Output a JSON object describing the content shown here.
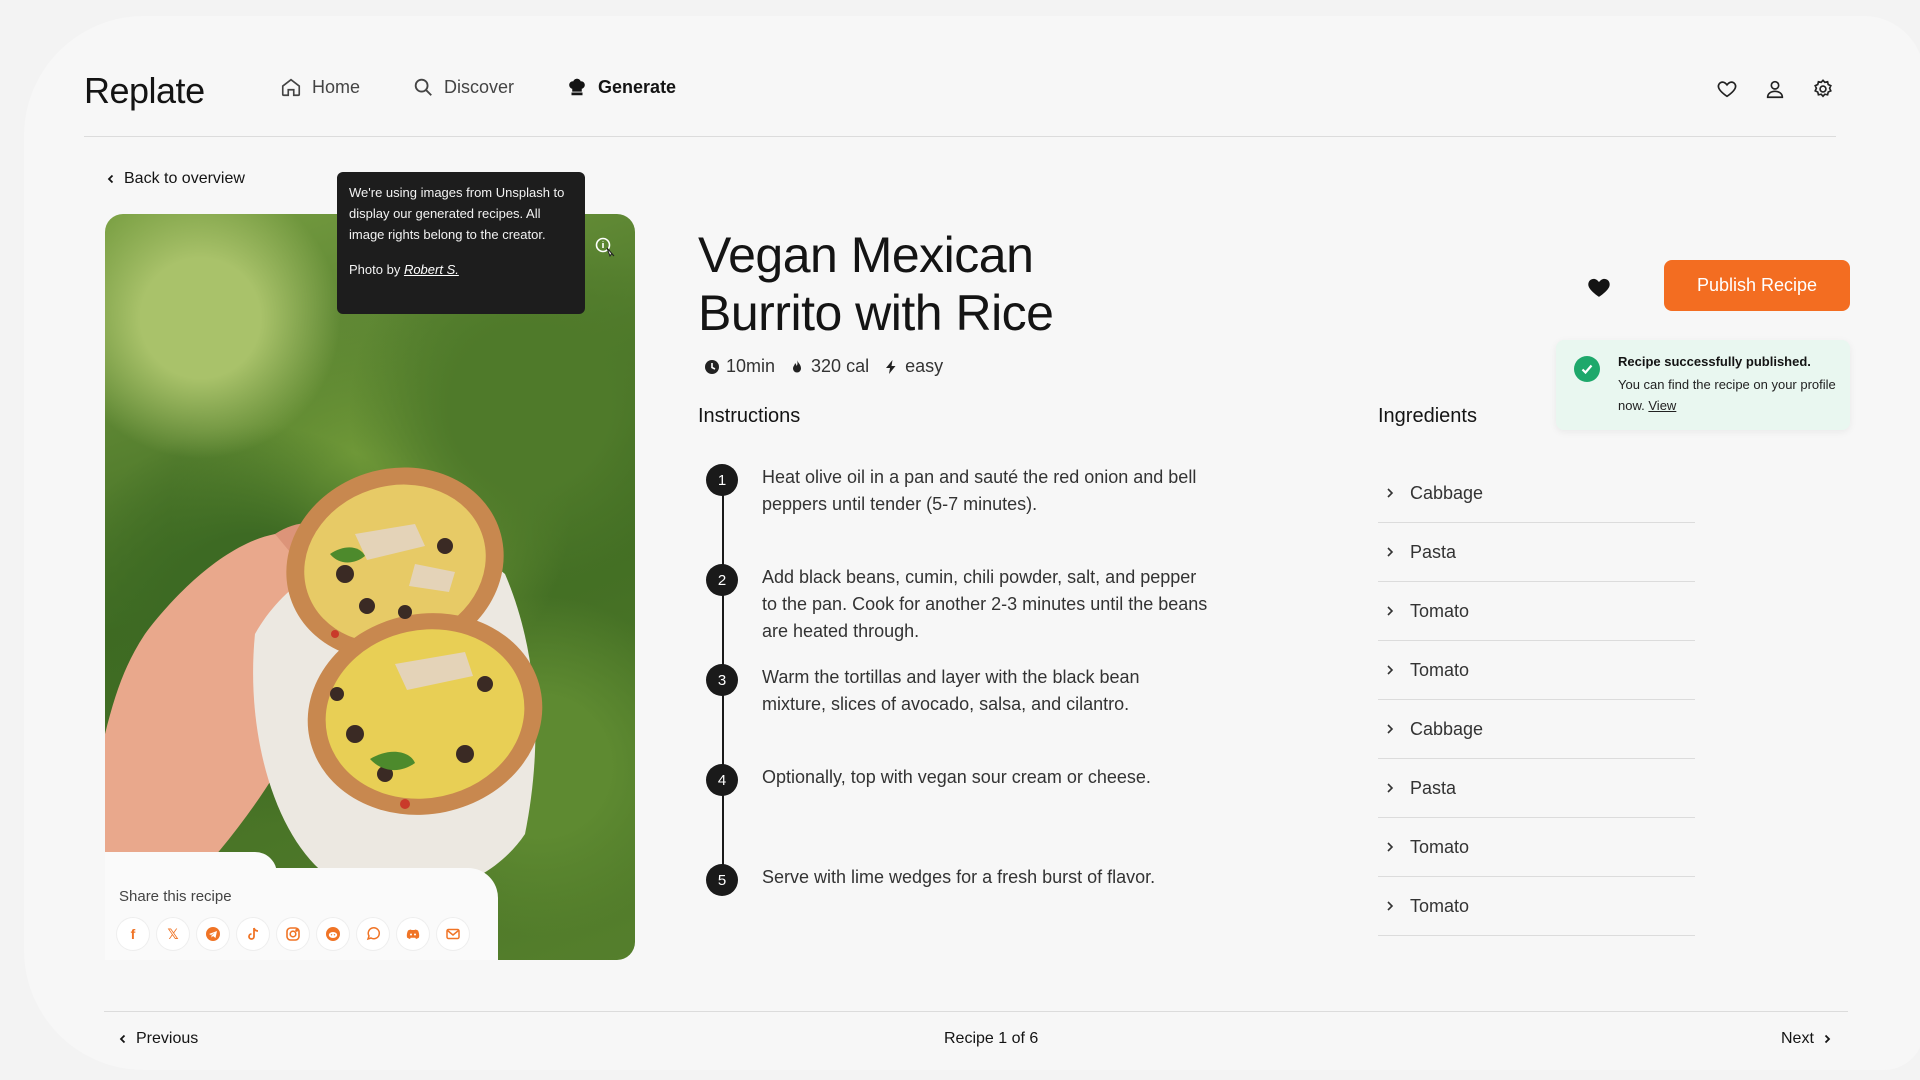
{
  "app": {
    "logo": "Replate"
  },
  "nav": [
    {
      "label": "Home",
      "icon": "home-icon",
      "active": false
    },
    {
      "label": "Discover",
      "icon": "search-icon",
      "active": false
    },
    {
      "label": "Generate",
      "icon": "chef-hat-icon",
      "active": true
    }
  ],
  "header_icons": [
    "heart-icon",
    "user-icon",
    "gear-icon"
  ],
  "back_label": "Back to overview",
  "tooltip": {
    "text": "We're using images from Unsplash to display our generated recipes. All image rights belong to the creator.",
    "credit_prefix": "Photo by ",
    "credit_name": "Robert S."
  },
  "share": {
    "title": "Share this recipe",
    "networks": [
      "facebook",
      "x",
      "telegram",
      "tiktok",
      "instagram",
      "reddit",
      "whatsapp",
      "discord",
      "email"
    ]
  },
  "recipe": {
    "title_line1": "Vegan Mexican",
    "title_line2": "Burrito with Rice",
    "time": "10min",
    "calories": "320 cal",
    "difficulty": "easy"
  },
  "actions": {
    "publish_label": "Publish Recipe"
  },
  "toast": {
    "title": "Recipe successfully published.",
    "body": "You can find the recipe on your profile now.",
    "link": "View"
  },
  "instructions": {
    "heading": "Instructions",
    "steps": [
      {
        "num": "1",
        "text": "Heat olive oil in a pan and sauté the red onion and bell peppers until tender (5-7 minutes)."
      },
      {
        "num": "2",
        "text": "Add black beans, cumin, chili powder, salt, and pepper to the pan. Cook for another 2-3 minutes until the beans are heated through."
      },
      {
        "num": "3",
        "text": "Warm the tortillas and layer with the black bean mixture, slices of avocado, salsa, and cilantro."
      },
      {
        "num": "4",
        "text": "Optionally, top with vegan sour cream or cheese."
      },
      {
        "num": "5",
        "text": "Serve with lime wedges for a fresh burst of flavor."
      }
    ]
  },
  "ingredients": {
    "heading": "Ingredients",
    "items": [
      "Cabbage",
      "Pasta",
      "Tomato",
      "Tomato",
      "Cabbage",
      "Pasta",
      "Tomato",
      "Tomato"
    ]
  },
  "footer": {
    "previous": "Previous",
    "pager": "Recipe 1 of 6",
    "next": "Next"
  },
  "colors": {
    "accent": "#f36d21",
    "success": "#1ea86b",
    "dark": "#1a1a1a"
  }
}
